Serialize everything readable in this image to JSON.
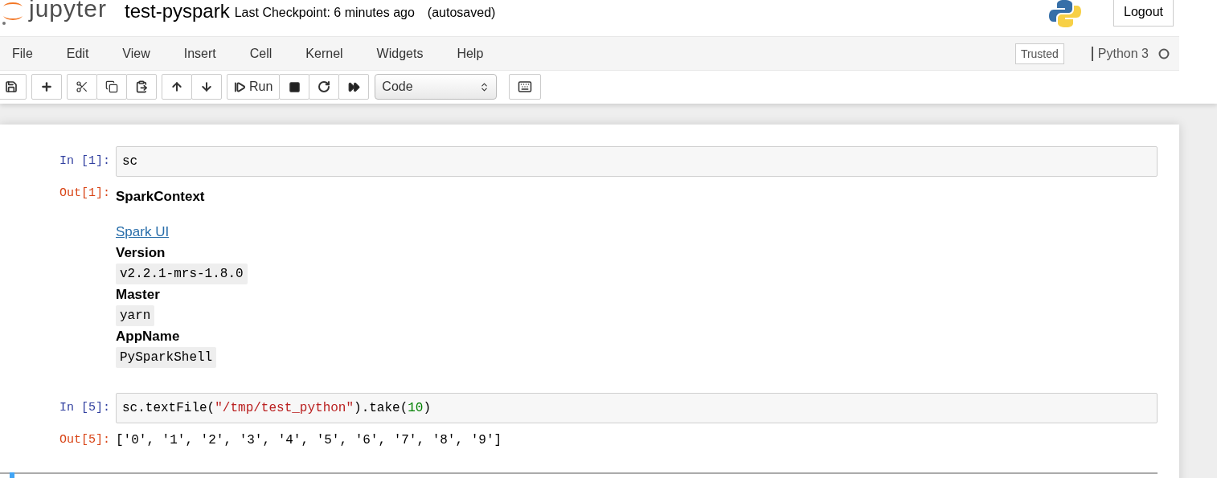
{
  "header": {
    "logo_text": "jupyter",
    "notebook_name": "test-pyspark",
    "checkpoint": "Last Checkpoint: 6 minutes ago",
    "autosave": "(autosaved)",
    "logout": "Logout"
  },
  "menu": [
    "File",
    "Edit",
    "View",
    "Insert",
    "Cell",
    "Kernel",
    "Widgets",
    "Help"
  ],
  "trusted": "Trusted",
  "kernel": {
    "name": "Python 3",
    "busy": false
  },
  "toolbar": {
    "run_label": "Run",
    "cell_type": "Code"
  },
  "cells": [
    {
      "selected": false,
      "prompt_in": "In [1]:",
      "code": [
        {
          "kind": "plain",
          "text": "sc"
        }
      ],
      "prompt_out": "Out[1]:",
      "output": {
        "kind": "spark",
        "title": "SparkContext",
        "link": "Spark UI",
        "fields": [
          {
            "label": "Version",
            "value": "v2.2.1-mrs-1.8.0"
          },
          {
            "label": "Master",
            "value": "yarn"
          },
          {
            "label": "AppName",
            "value": "PySparkShell"
          }
        ]
      }
    },
    {
      "selected": false,
      "prompt_in": "In [5]:",
      "code": [
        {
          "kind": "plain",
          "text": "sc.textFile("
        },
        {
          "kind": "string",
          "text": "\"/tmp/test_python\""
        },
        {
          "kind": "plain",
          "text": ").take("
        },
        {
          "kind": "number",
          "text": "10"
        },
        {
          "kind": "plain",
          "text": ")"
        }
      ],
      "prompt_out": "Out[5]:",
      "output": {
        "kind": "text",
        "text": "['0', '1', '2', '3', '4', '5', '6', '7', '8', '9']"
      }
    },
    {
      "selected": true
    }
  ]
}
